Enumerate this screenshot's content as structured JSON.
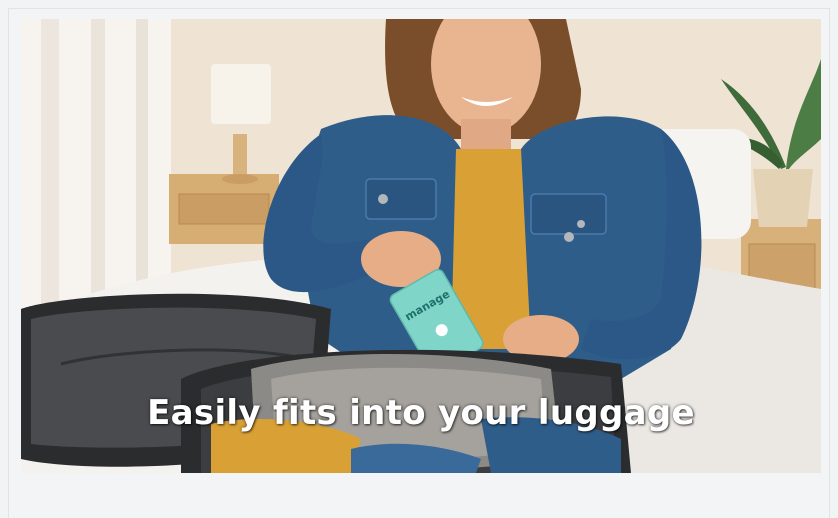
{
  "media": {
    "caption": "Easily fits into your luggage",
    "icon": "photo-icon"
  },
  "packet": {
    "brand_text": "manage"
  },
  "colors": {
    "background": "#f2f3f5",
    "caption_text": "#ffffff",
    "denim": "#2f5d8a",
    "sweater": "#d9a135",
    "packet": "#7fd6c8"
  }
}
